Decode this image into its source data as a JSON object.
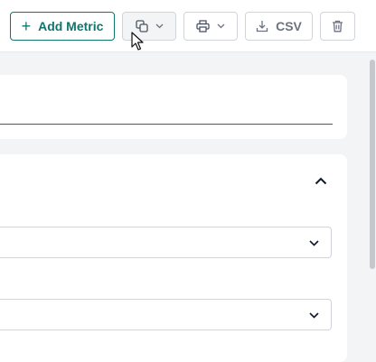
{
  "toolbar": {
    "add_metric_label": "Add Metric",
    "csv_label": "CSV",
    "icons": {
      "add": "plus-icon",
      "copy": "copy-icon",
      "print": "printer-icon",
      "download": "download-icon",
      "delete": "trash-icon",
      "dropdown": "chevron-down-icon"
    }
  },
  "cards": {
    "collapse_icon": "chevron-up-icon",
    "select_icon": "chevron-down-icon"
  },
  "colors": {
    "accent": "#0f766e",
    "background": "#f3f4f6",
    "border": "#d1d5db"
  }
}
